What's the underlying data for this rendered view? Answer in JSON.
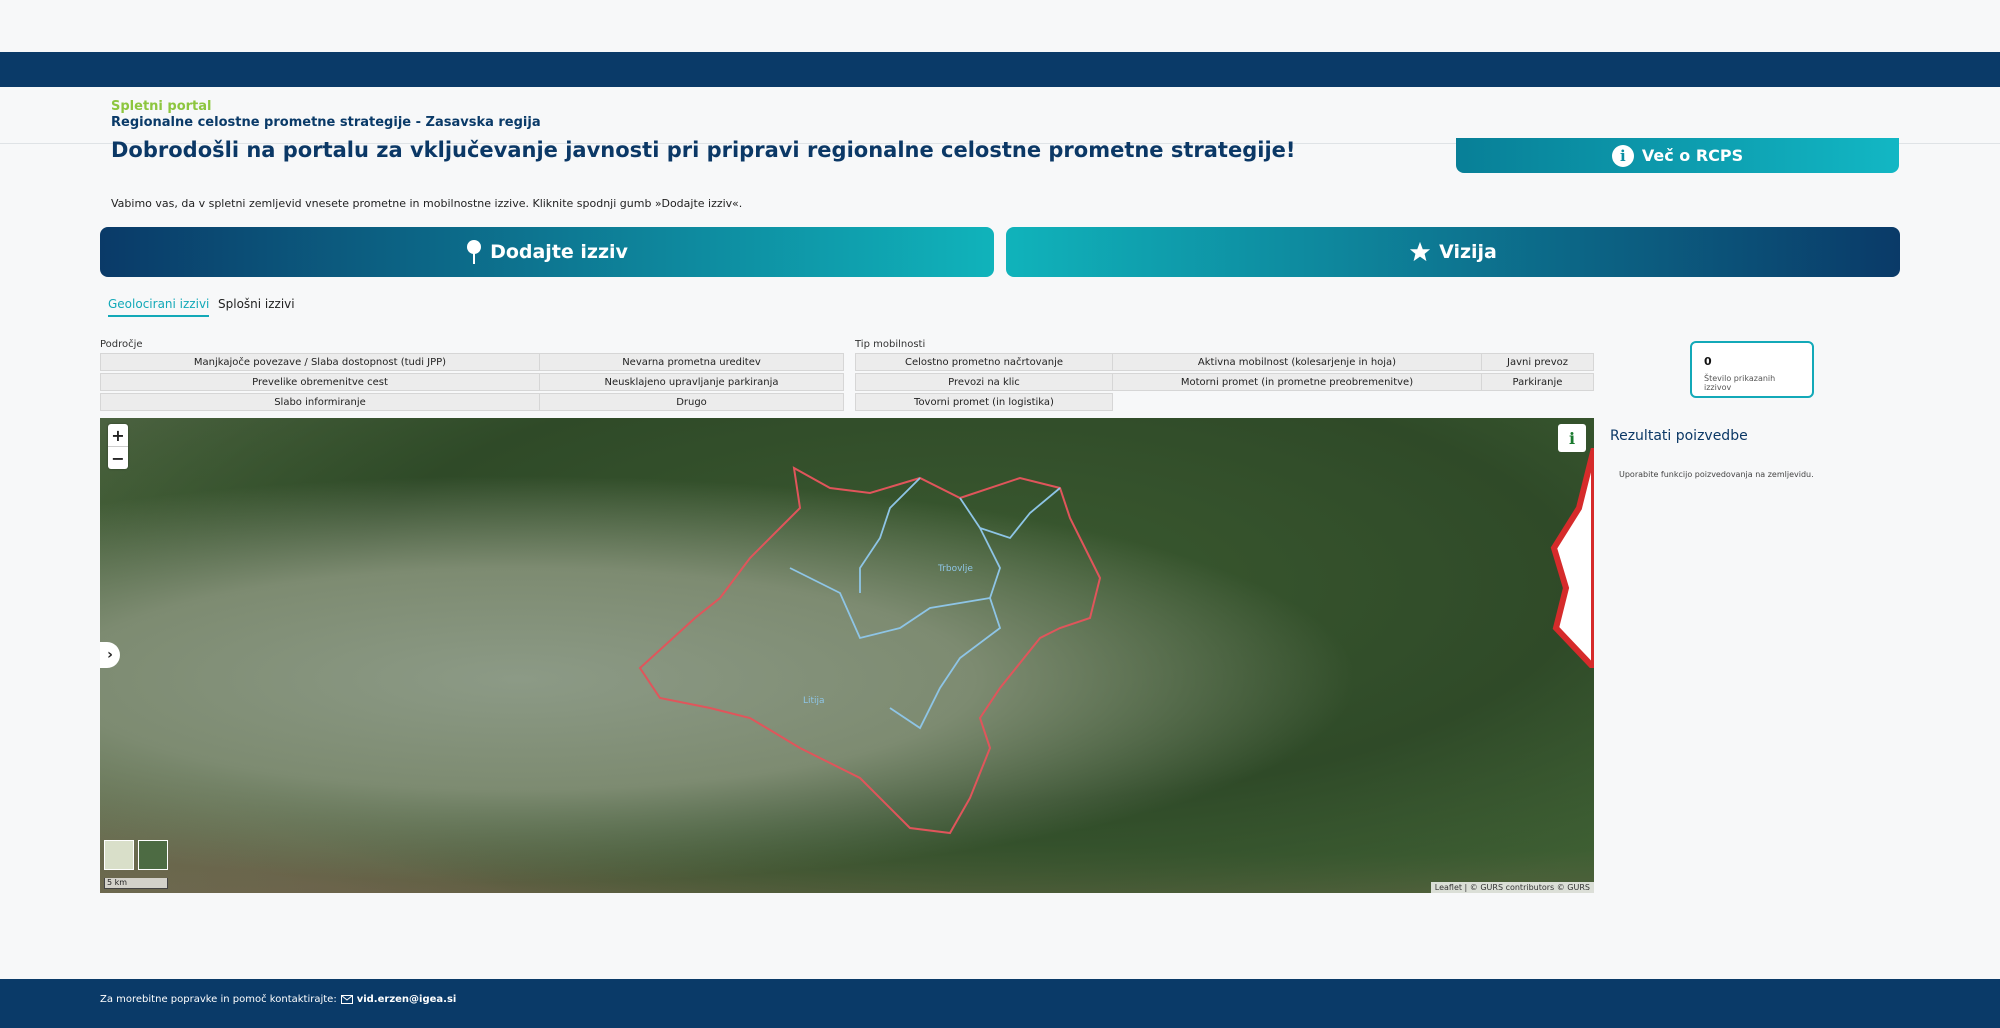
{
  "header": {
    "brand_line1": "Spletni portal",
    "brand_line2": "Regionalne celostne prometne strategije - Zasavska regija"
  },
  "welcome": {
    "title": "Dobrodošli na portalu za vključevanje javnosti pri pripravi regionalne celostne prometne strategije!",
    "more_button": "Več o RCPS",
    "intro": "Vabimo vas, da v spletni zemljevid vnesete prometne in mobilnostne izzive. Kliknite spodnji gumb »Dodajte izziv«."
  },
  "actions": {
    "add_challenge": "Dodajte izziv",
    "vision": "Vizija"
  },
  "tabs": {
    "geolocated": "Geolocirani izzivi",
    "general": "Splošni izzivi"
  },
  "filters": {
    "area_label": "Področje",
    "area_items": [
      "Manjkajoče povezave / Slaba dostopnost (tudi JPP)",
      "Nevarna prometna ureditev",
      "Prevelike obremenitve cest",
      "Neusklajeno upravljanje parkiranja",
      "Slabo informiranje",
      "Drugo"
    ],
    "mobility_label": "Tip mobilnosti",
    "mobility_items": [
      "Celostno prometno načrtovanje",
      "Aktivna mobilnost (kolesarjenje in hoja)",
      "Javni prevoz",
      "Prevozi na klic",
      "Motorni promet (in prometne preobremenitve)",
      "Parkiranje",
      "Tovorni promet (in logistika)"
    ]
  },
  "counter": {
    "value": "0",
    "label": "Število prikazanih izzivov"
  },
  "map": {
    "zoom_in": "+",
    "zoom_out": "−",
    "info": "i",
    "toggle": "›",
    "scale": "5 km",
    "attribution": "Leaflet | © GURS contributors © GURS",
    "place_labels": [
      "Litija",
      "Trbovlje"
    ],
    "region_border_color": "#e0555b",
    "municipal_border_color": "#8ec5e6"
  },
  "results": {
    "title": "Rezultati poizvedbe",
    "hint": "Uporabite funkcijo poizvedovanja na zemljevidu."
  },
  "footer": {
    "text": "Za morebitne popravke in pomoč kontaktirajte:",
    "email": "vid.erzen@igea.si"
  }
}
